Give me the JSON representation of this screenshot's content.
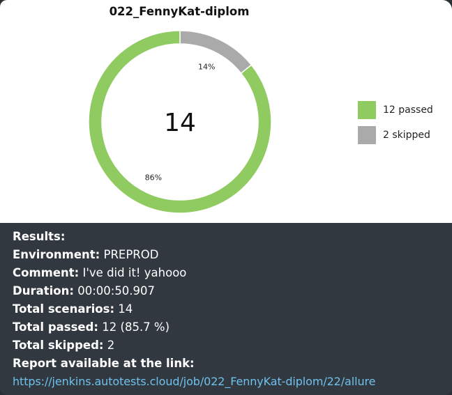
{
  "message": {
    "chart": {
      "title": "022_FennyKat-diplom",
      "center_label": "14"
    },
    "results": {
      "heading": "Results:",
      "environment_label": "Environment:",
      "environment_value": "PREPROD",
      "comment_label": "Comment:",
      "comment_value": "I've did it! yahooo",
      "duration_label": "Duration:",
      "duration_value": "00:00:50.907",
      "total_scenarios_label": "Total scenarios:",
      "total_scenarios_value": "14",
      "total_passed_label": "Total passed:",
      "total_passed_value": "12 (85.7 %)",
      "total_skipped_label": "Total skipped:",
      "total_skipped_value": "2",
      "report_label": "Report available at the link:",
      "report_link": "https://jenkins.autotests.cloud/job/022_FennyKat-diplom/22/allure"
    }
  },
  "chart_data": {
    "type": "pie",
    "title": "022_FennyKat-diplom",
    "total": 14,
    "series": [
      {
        "name": "12 passed",
        "value": 12,
        "percent_label": "86%",
        "color": "#8fcb60"
      },
      {
        "name": "2 skipped",
        "value": 2,
        "percent_label": "14%",
        "color": "#aaaaaa"
      }
    ],
    "legend_position": "right"
  }
}
